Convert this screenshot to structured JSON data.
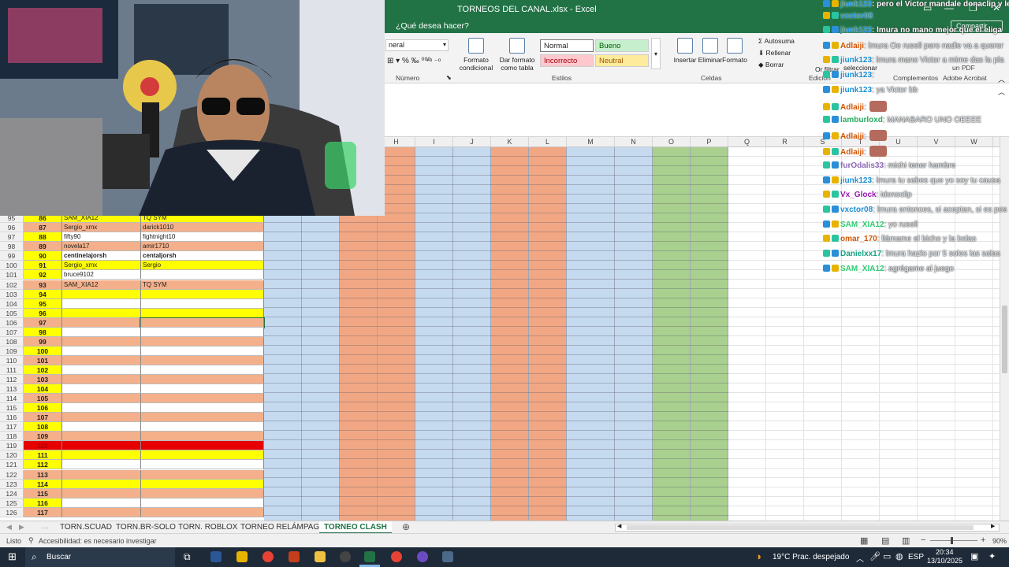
{
  "window": {
    "title": "TORNEOS DEL CANAL.xlsx  -  Excel",
    "share_label": "Compartir",
    "tell_me": "¿Qué desea hacer?"
  },
  "ribbon": {
    "number_format": "neral",
    "number_group_label": "Número",
    "cond_format_label": "Formato condicional",
    "table_format_label": "Dar formato como tabla",
    "styles": {
      "normal": "Normal",
      "bueno": "Bueno",
      "incorrecto": "Incorrecto",
      "neutral": "Neutral"
    },
    "styles_group_label": "Estilos",
    "insertar": "Insertar",
    "eliminar": "Eliminar",
    "formato": "Formato",
    "celdas_group_label": "Celdas",
    "autosuma": "Autosuma",
    "rellenar": "Rellenar",
    "borrar": "Borrar",
    "edicion_group_label": "Edición",
    "ordenar_filtrar": "Or filtrar",
    "buscar_seleccionar": "seleccionar",
    "complementos": "Complementos",
    "adobe": "Adobe Acrobat",
    "crear_pdf": "un PDF"
  },
  "columns": [
    "H",
    "I",
    "J",
    "K",
    "L",
    "M",
    "N",
    "O",
    "P",
    "Q",
    "R",
    "S",
    "T",
    "U",
    "V",
    "W"
  ],
  "rows": [
    {
      "rn": "95",
      "a": "86",
      "b": "SAM_XIA12",
      "c": "TQ SYM",
      "style": "yellow"
    },
    {
      "rn": "96",
      "a": "87",
      "b": "Sergio_xmx",
      "c": "darick1010",
      "style": "orange"
    },
    {
      "rn": "97",
      "a": "88",
      "b": "fifty90",
      "c": "fightnight10",
      "style": "white"
    },
    {
      "rn": "98",
      "a": "89",
      "b": "novela17",
      "c": "amir1710",
      "style": "orange"
    },
    {
      "rn": "99",
      "a": "90",
      "b": "centinelajorsh",
      "c": "centaljorsh",
      "style": "white-bold"
    },
    {
      "rn": "100",
      "a": "91",
      "b": "Sergio_xmx",
      "c": "Sergio",
      "style": "yellow"
    },
    {
      "rn": "101",
      "a": "92",
      "b": "bruce9102",
      "c": "",
      "style": "white"
    },
    {
      "rn": "102",
      "a": "93",
      "b": "SAM_XIA12",
      "c": "TQ SYM",
      "style": "orange"
    },
    {
      "rn": "103",
      "a": "94",
      "b": "",
      "c": "",
      "style": "yellow"
    },
    {
      "rn": "104",
      "a": "95",
      "b": "",
      "c": "",
      "style": "white"
    },
    {
      "rn": "105",
      "a": "96",
      "b": "",
      "c": "",
      "style": "yellow"
    },
    {
      "rn": "106",
      "a": "97",
      "b": "",
      "c": "",
      "style": "orange"
    },
    {
      "rn": "107",
      "a": "98",
      "b": "",
      "c": "",
      "style": "white"
    },
    {
      "rn": "108",
      "a": "99",
      "b": "",
      "c": "",
      "style": "orange"
    },
    {
      "rn": "109",
      "a": "100",
      "b": "",
      "c": "",
      "style": "white"
    },
    {
      "rn": "110",
      "a": "101",
      "b": "",
      "c": "",
      "style": "orange"
    },
    {
      "rn": "111",
      "a": "102",
      "b": "",
      "c": "",
      "style": "white"
    },
    {
      "rn": "112",
      "a": "103",
      "b": "",
      "c": "",
      "style": "orange"
    },
    {
      "rn": "113",
      "a": "104",
      "b": "",
      "c": "",
      "style": "white"
    },
    {
      "rn": "114",
      "a": "105",
      "b": "",
      "c": "",
      "style": "orange"
    },
    {
      "rn": "115",
      "a": "106",
      "b": "",
      "c": "",
      "style": "white"
    },
    {
      "rn": "116",
      "a": "107",
      "b": "",
      "c": "",
      "style": "orange"
    },
    {
      "rn": "117",
      "a": "108",
      "b": "",
      "c": "",
      "style": "white"
    },
    {
      "rn": "118",
      "a": "109",
      "b": "",
      "c": "",
      "style": "orange"
    },
    {
      "rn": "119",
      "a": "110",
      "b": "",
      "c": "",
      "style": "red"
    },
    {
      "rn": "120",
      "a": "111",
      "b": "",
      "c": "",
      "style": "yellow"
    },
    {
      "rn": "121",
      "a": "112",
      "b": "",
      "c": "",
      "style": "white"
    },
    {
      "rn": "122",
      "a": "113",
      "b": "",
      "c": "",
      "style": "orange"
    },
    {
      "rn": "123",
      "a": "114",
      "b": "",
      "c": "",
      "style": "yellow"
    },
    {
      "rn": "124",
      "a": "115",
      "b": "",
      "c": "",
      "style": "orange"
    },
    {
      "rn": "125",
      "a": "116",
      "b": "",
      "c": "",
      "style": "white"
    },
    {
      "rn": "126",
      "a": "117",
      "b": "",
      "c": "",
      "style": "orange"
    }
  ],
  "chat": [
    {
      "user": "jiunk123",
      "msg": ": pero el Victor mandale donaclip y le",
      "uc": "#1a8fd6",
      "top": true
    },
    {
      "user": "vxctor08",
      "msg": "",
      "uc": "#1a8fd6"
    },
    {
      "user": "jiunk123",
      "msg": ": lmura no mano mejor que el eliga",
      "uc": "#1a8fd6"
    },
    {
      "user": "Adlaiji",
      "msg": ": lmura Oe rusell pero nadie va a querer",
      "uc": "#d35400"
    },
    {
      "user": "jiunk123",
      "msg": ": lmura mano Victor a mime das la pla",
      "uc": "#1a8fd6"
    },
    {
      "user": "jiunk123",
      "msg": ":",
      "uc": "#1a8fd6"
    },
    {
      "user": "jiunk123",
      "msg": ": ya Victor bb",
      "uc": "#1a8fd6"
    },
    {
      "user": "Adlaiji",
      "msg": ":",
      "uc": "#d35400"
    },
    {
      "user": "lamburloxd",
      "msg": ": MANABARO UNO OEEEE",
      "uc": "#27ae60"
    },
    {
      "user": "Adlaiji",
      "msg": ":",
      "uc": "#d35400"
    },
    {
      "user": "Adlaiji",
      "msg": ":",
      "uc": "#d35400"
    },
    {
      "user": "furOdalis33",
      "msg": ": michi tener hambre",
      "uc": "#8e6bb5"
    },
    {
      "user": "jiunk123",
      "msg": ": lmura tu sabes que yo soy tu causa",
      "uc": "#1a8fd6"
    },
    {
      "user": "Vx_Glock",
      "msg": ": idonoclip",
      "uc": "#9b1bb0"
    },
    {
      "user": "vxctor08",
      "msg": ": lmura entonces, si aceptan, si es pos",
      "uc": "#1a8fd6"
    },
    {
      "user": "SAM_XIA12",
      "msg": ": yo rusell",
      "uc": "#2ecc71"
    },
    {
      "user": "omar_170",
      "msg": ": llámame el bicho y la bolas",
      "uc": "#d35400"
    },
    {
      "user": "Danielxx17",
      "msg": ": lmura hazlo por 5 soles las salas",
      "uc": "#16a085"
    },
    {
      "user": "SAM_XIA12",
      "msg": ": agrégame al juego",
      "uc": "#2ecc71"
    }
  ],
  "sheet_tabs": [
    "TORN.SCUAD",
    "TORN.BR-SOLO",
    "TORN. ROBLOX",
    "TORNEO RELÁMPAGO",
    "TORNEO CLASH"
  ],
  "active_tab": "TORNEO CLASH",
  "status": {
    "ready": "Listo",
    "accessibility": "Accesibilidad: es necesario investigar",
    "zoom": "90%"
  },
  "taskbar": {
    "search": "Buscar",
    "weather": "19°C  Prac. despejado",
    "lang": "ESP",
    "time": "20:34",
    "date": "13/10/2025"
  },
  "colors": {
    "excel_green": "#217346",
    "orange_cell": "#f4b08a",
    "yellow_cell": "#ffff00",
    "red_cell": "#e60000",
    "blue_col": "#c5d9ef",
    "salmon_col": "#f1a783",
    "green_col": "#a9d08e"
  }
}
